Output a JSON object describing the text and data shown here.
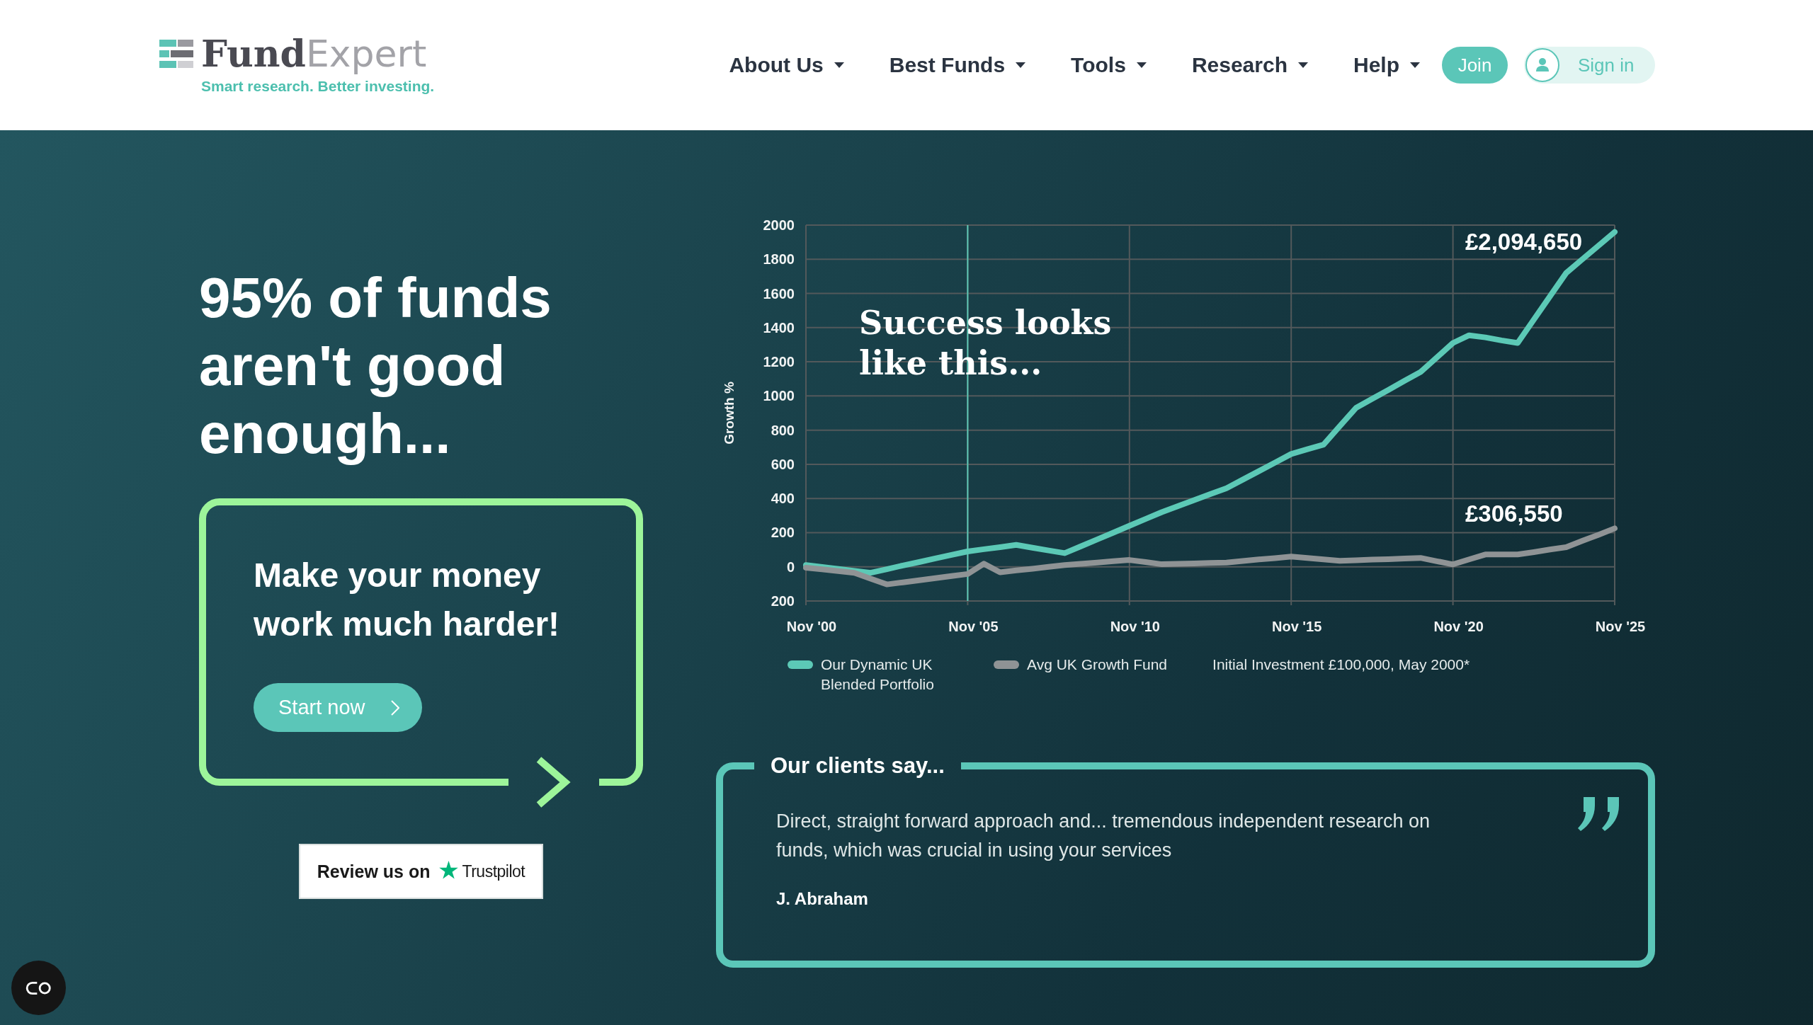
{
  "header": {
    "logo": {
      "wordmark": "**Fund**Expert",
      "tagline": "Smart research. Better investing."
    },
    "nav": [
      {
        "label": "About Us",
        "has_menu": true
      },
      {
        "label": "Best Funds",
        "has_menu": true
      },
      {
        "label": "Tools",
        "has_menu": true
      },
      {
        "label": "Research",
        "has_menu": true
      },
      {
        "label": "Help",
        "has_menu": true
      }
    ],
    "join_button": {
      "label": "Join"
    },
    "sign_in_button": {
      "label": "Sign in"
    }
  },
  "hero": {
    "headline": "95% of funds aren't good enough...",
    "callout": {
      "text": "Make your money work much harder!",
      "button": "Start now"
    },
    "review_badge": {
      "text": "Review us on",
      "brand": "Trustpilot"
    }
  },
  "chart": {
    "chart_data": {
      "type": "line",
      "ylabel": "Growth %",
      "categories": [
        "Nov '00",
        null,
        null,
        null,
        null,
        null,
        null,
        null,
        null,
        null,
        "Nov '05",
        null,
        null,
        null,
        null,
        null,
        null,
        null,
        null,
        null,
        "Nov '10",
        null,
        null,
        null,
        null,
        null,
        null,
        null,
        null,
        null,
        "Nov '15",
        null,
        null,
        null,
        null,
        null,
        null,
        null,
        null,
        null,
        "Nov '20",
        null,
        null,
        null,
        null,
        null,
        null,
        null,
        null,
        null,
        "Nov '25"
      ],
      "series": [
        {
          "name": "Our Dynamic UK Blended Portfolio",
          "color": "#5cc9b6",
          "values": [
            10,
            -1,
            -12,
            -24,
            -35,
            -14,
            8,
            28,
            49,
            70,
            90,
            103,
            115,
            128,
            112,
            96,
            80,
            120,
            160,
            200,
            240,
            280,
            320,
            355,
            390,
            425,
            460,
            510,
            560,
            610,
            660,
            688,
            715,
            823,
            930,
            983,
            1035,
            1088,
            1140,
            1225,
            1310,
            1355,
            1343,
            1325,
            1310,
            1447,
            1583,
            1720,
            1800,
            1880,
            1960
          ]
        },
        {
          "name": "Avg UK Growth Fund",
          "color": "#8f9395",
          "values": [
            -5,
            -15,
            -25,
            -35,
            -69,
            -103,
            -91,
            -79,
            -66,
            -54,
            -42,
            18,
            -32,
            -21,
            -11,
            0,
            10,
            18,
            25,
            33,
            40,
            28,
            15,
            18,
            20,
            23,
            25,
            34,
            43,
            51,
            60,
            52,
            43,
            35,
            38,
            42,
            45,
            49,
            52,
            33,
            14,
            43,
            72,
            72,
            72,
            86,
            101,
            115,
            152,
            188,
            225
          ]
        }
      ],
      "ylim": [
        -200,
        2000
      ],
      "yticks": [
        {
          "value": -200,
          "label": "200"
        },
        0,
        200,
        400,
        600,
        800,
        1000,
        1200,
        1400,
        1600,
        1800,
        2000
      ],
      "grid": true,
      "annotations": [
        "Success looks like this...",
        "£2,094,650",
        "£306,550"
      ],
      "ref_lines": [
        {
          "axis": "x",
          "value": "Nov '05"
        }
      ]
    },
    "footnote": "Initial Investment £100,000, May 2000*"
  },
  "testimonials": {
    "title": "Our clients say...",
    "quote": "Direct, straight forward approach and... tremendous independent research on funds, which was crucial in using your services",
    "author": "J. Abraham"
  }
}
